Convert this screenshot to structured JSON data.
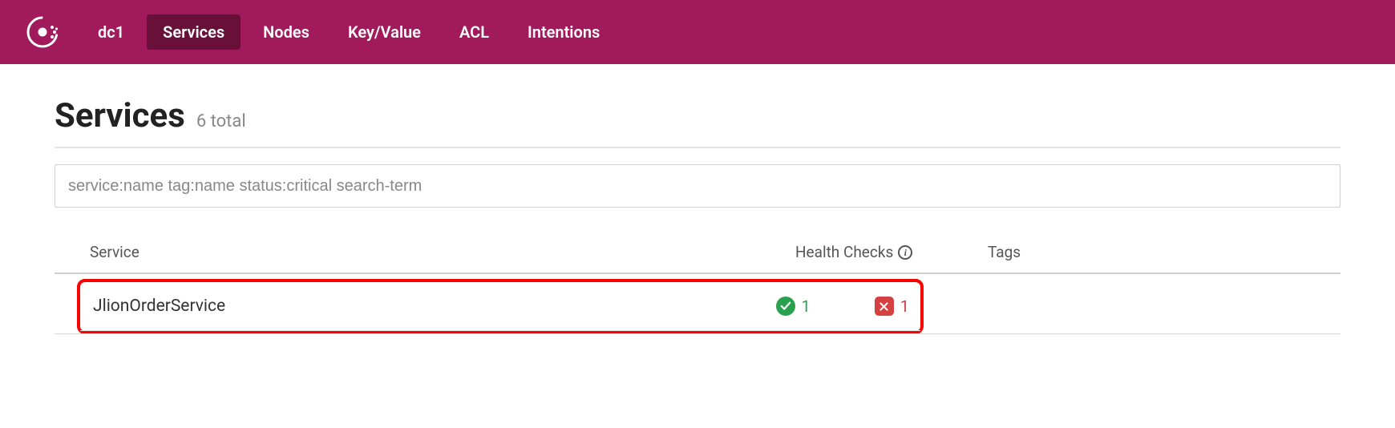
{
  "nav": {
    "datacenter": "dc1",
    "items": [
      "Services",
      "Nodes",
      "Key/Value",
      "ACL",
      "Intentions"
    ],
    "active": "Services"
  },
  "page": {
    "title": "Services",
    "count_text": "6 total"
  },
  "search": {
    "placeholder": "service:name tag:name status:critical search-term"
  },
  "table": {
    "headers": {
      "service": "Service",
      "health": "Health Checks",
      "tags": "Tags"
    },
    "rows": [
      {
        "name": "JlionOrderService",
        "passing": 1,
        "failing": 1
      }
    ]
  }
}
